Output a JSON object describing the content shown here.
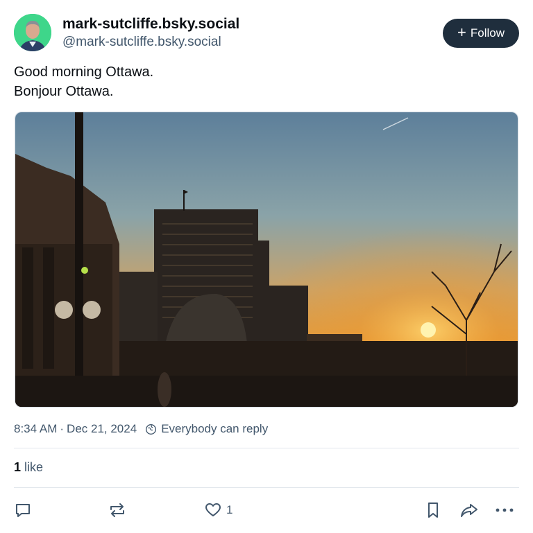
{
  "author": {
    "display_name": "mark-sutcliffe.bsky.social",
    "handle": "@mark-sutcliffe.bsky.social",
    "avatar_bg": "#3ed68a"
  },
  "follow_button": {
    "icon": "plus-icon",
    "label": "Follow",
    "bg": "#1f2e3d"
  },
  "post": {
    "lines": [
      "Good morning Ottawa.",
      "Bonjour Ottawa."
    ],
    "image": {
      "subject": "sunset-over-ottawa-skyline"
    }
  },
  "meta": {
    "time": "8:34 AM",
    "separator": "·",
    "date": "Dec 21, 2024",
    "reply_icon": "globe-icon",
    "reply_setting": "Everybody can reply"
  },
  "stats": {
    "likes_count": "1",
    "likes_label": "like"
  },
  "actions": {
    "reply_icon": "reply-icon",
    "repost_icon": "repost-icon",
    "like_icon": "heart-icon",
    "like_count": "1",
    "bookmark_icon": "bookmark-icon",
    "share_icon": "share-icon",
    "more_icon": "more-icon"
  }
}
